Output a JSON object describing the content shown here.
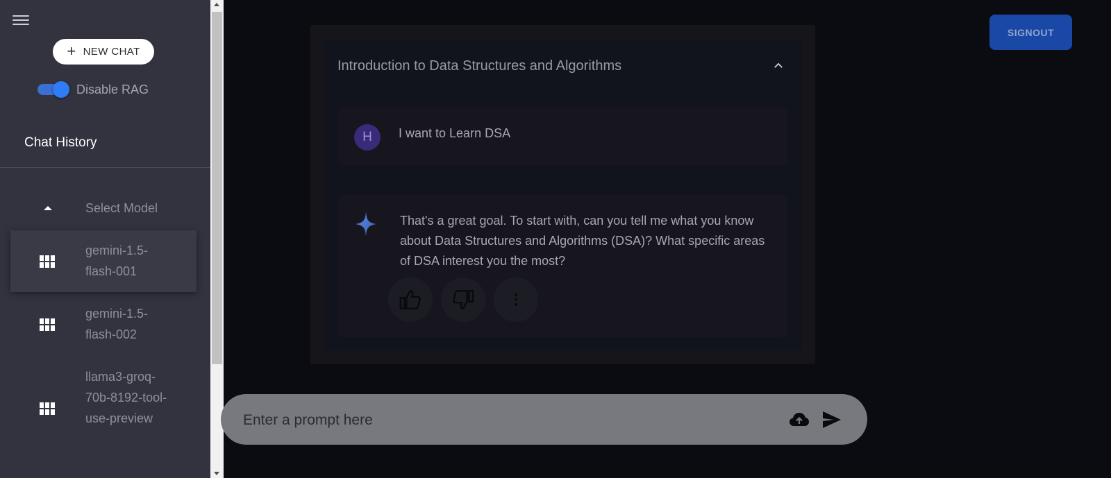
{
  "sidebar": {
    "new_chat_label": "NEW CHAT",
    "rag_toggle_label": "Disable RAG",
    "history_title": "Chat History",
    "model_header_label": "Select Model",
    "models": [
      {
        "label": "gemini-1.5-flash-001",
        "selected": true
      },
      {
        "label": "gemini-1.5-flash-002",
        "selected": false
      },
      {
        "label": "llama3-groq-70b-8192-tool-use-preview",
        "selected": false
      }
    ]
  },
  "header": {
    "signout_label": "SIGNOUT"
  },
  "chat": {
    "title": "Introduction to Data Structures and Algorithms",
    "user_avatar_letter": "H",
    "user_message": "I want to Learn DSA",
    "bot_message": "That's a great goal. To start with, can you tell me what you know about Data Structures and Algorithms (DSA)? What specific areas of DSA interest you the most?"
  },
  "prompt": {
    "placeholder": "Enter a prompt here"
  },
  "colors": {
    "sidebar_bg": "#33323f",
    "page_bg": "#0b0b12",
    "accent": "#2f7cf6",
    "signout_bg": "#1a48a6",
    "prompt_bg": "#77797e"
  },
  "icons": {
    "menu": "hamburger-menu-icon",
    "new_chat": "plus-icon",
    "model_collapse": "caret-up-icon",
    "model": "grid-icon",
    "chat_collapse": "chevron-up-icon",
    "bot": "sparkle-icon",
    "like": "thumbs-up-icon",
    "dislike": "thumbs-down-icon",
    "more": "more-vert-icon",
    "upload": "cloud-upload-icon",
    "send": "send-icon"
  }
}
